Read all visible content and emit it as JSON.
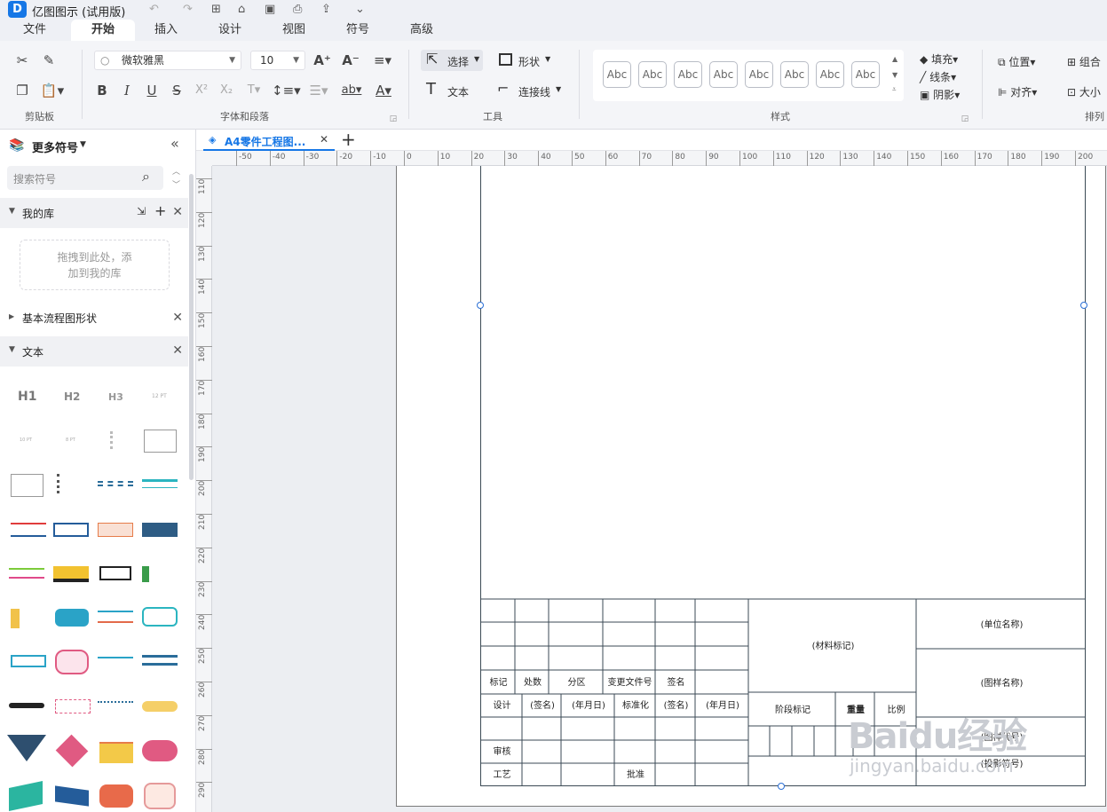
{
  "app": {
    "title": "亿图图示 (试用版)",
    "logo_letter": "D"
  },
  "menu_tabs": [
    "文件",
    "开始",
    "插入",
    "设计",
    "视图",
    "符号",
    "高级"
  ],
  "active_tab": "开始",
  "ribbon": {
    "groups": [
      "剪贴板",
      "字体和段落",
      "工具",
      "样式",
      "排列"
    ],
    "font_name": "微软雅黑",
    "font_size": "10",
    "tools": {
      "select": "选择",
      "shape": "形状",
      "text": "文本",
      "connector": "连接线"
    },
    "style_sample": "Abc",
    "style_sample_count": 8,
    "fill": "填充",
    "line": "线条",
    "shadow": "阴影",
    "position": "位置",
    "combine": "组合",
    "align": "对齐",
    "size": "大小"
  },
  "left_panel": {
    "title": "更多符号",
    "search_placeholder": "搜索符号",
    "library": {
      "title": "我的库",
      "drop_hint_line1": "拖拽到此处，添",
      "drop_hint_line2": "加到我的库"
    },
    "sections": [
      {
        "title": "基本流程图形状",
        "expanded": false
      },
      {
        "title": "文本",
        "expanded": true
      }
    ],
    "text_symbols": [
      "H1",
      "H2",
      "H3",
      "12 PT",
      "10 PT",
      "8 PT"
    ]
  },
  "document": {
    "tab_title": "A4零件工程图..."
  },
  "ruler": {
    "h_labels": [
      "-50",
      "-40",
      "-30",
      "-20",
      "-10",
      "0",
      "10",
      "20",
      "30",
      "40",
      "50",
      "60",
      "70",
      "80",
      "90",
      "100",
      "110",
      "120",
      "130",
      "140",
      "150",
      "160",
      "170",
      "180",
      "190",
      "200"
    ],
    "v_labels": [
      "110",
      "120",
      "130",
      "140",
      "150",
      "160",
      "170",
      "180",
      "190",
      "200",
      "210",
      "220",
      "230",
      "240",
      "250",
      "260",
      "270",
      "280",
      "290"
    ]
  },
  "title_block": {
    "row_labels_1": [
      "标记",
      "处数",
      "分区",
      "变更文件号",
      "签名"
    ],
    "row_labels_2": [
      "设计",
      "(签名)",
      "(年月日)",
      "标准化",
      "(签名)",
      "(年月日)"
    ],
    "review": "审核",
    "craft": "工艺",
    "approve": "批准",
    "material": "(材料标记)",
    "stage": "阶段标记",
    "weight": "重量",
    "scale": "比例",
    "company": "(单位名称)",
    "drawing_name": "(图样名称)",
    "drawing_code": "(图样代号)",
    "projection": "(投影符号)"
  },
  "watermark": {
    "text": "Baidu经验",
    "url": "jingyan.baidu.com"
  },
  "colors": {
    "accent": "#1677e6",
    "frame": "#3b4a55"
  }
}
